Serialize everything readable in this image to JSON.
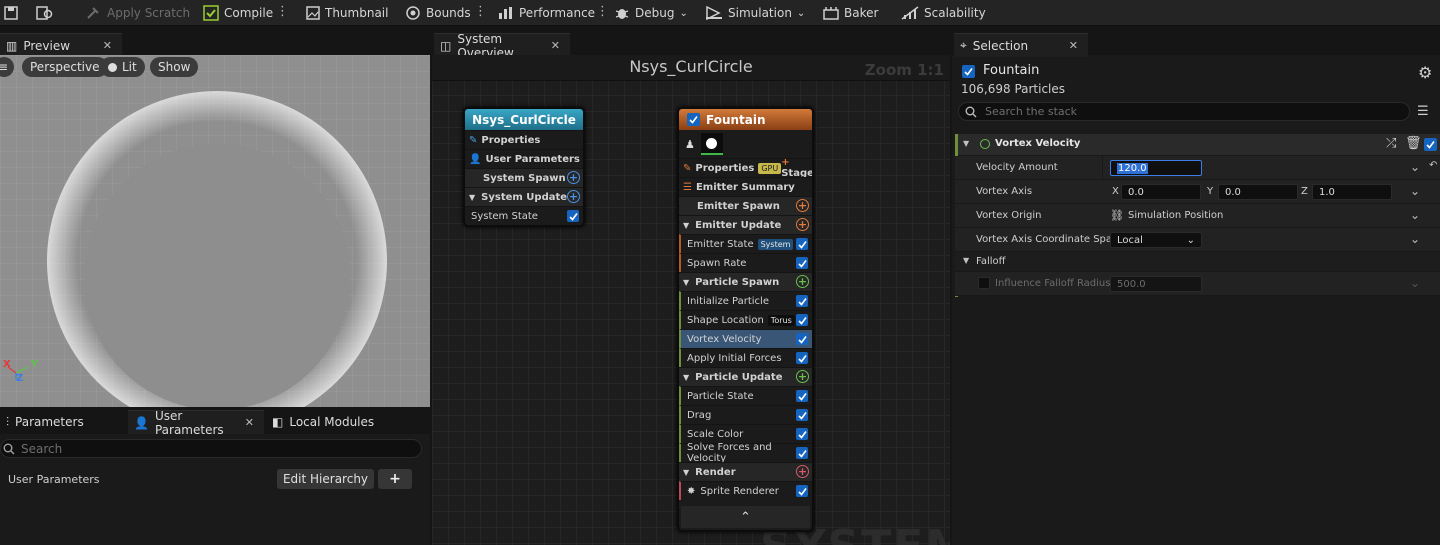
{
  "toolbar": {
    "apply_scratch": "Apply Scratch",
    "compile": "Compile",
    "thumbnail": "Thumbnail",
    "bounds": "Bounds",
    "performance": "Performance",
    "debug": "Debug",
    "simulation": "Simulation",
    "baker": "Baker",
    "scalability": "Scalability"
  },
  "preview": {
    "tab": "Preview",
    "view_mode": "Perspective",
    "lighting": "Lit",
    "show": "Show",
    "axis_x": "X",
    "axis_y": "Y",
    "axis_z": "Z"
  },
  "params": {
    "tabs": [
      "Parameters",
      "User Parameters",
      "Local Modules"
    ],
    "search_placeholder": "Search",
    "section_label": "User Parameters",
    "edit_hierarchy": "Edit Hierarchy",
    "add": "+"
  },
  "graph": {
    "tab": "System Overview",
    "title": "Nsys_CurlCircle",
    "zoom": "Zoom 1:1",
    "watermark": "SYSTEM",
    "system_node": {
      "title": "Nsys_CurlCircle",
      "rows": [
        "Properties",
        "User Parameters",
        "System Spawn",
        "System Update",
        "System State"
      ]
    },
    "emitter_node": {
      "title": "Fountain",
      "properties": "Properties",
      "gpu_badge": "GPU",
      "stage": "Stage",
      "rows": [
        "Emitter Summary",
        "Emitter Spawn",
        "Emitter Update",
        "Emitter State",
        "Spawn Rate",
        "Particle Spawn",
        "Initialize Particle",
        "Shape Location",
        "Vortex Velocity",
        "Apply Initial Forces",
        "Particle Update",
        "Particle State",
        "Drag",
        "Scale Color",
        "Solve Forces and Velocity",
        "Render",
        "Sprite Renderer"
      ],
      "emitter_state_badge": "System",
      "shape_location_badge": "Torus",
      "collapse": "⌃"
    }
  },
  "selection": {
    "tab": "Selection",
    "emitter_name": "Fountain",
    "particle_count": "106,698 Particles",
    "search_placeholder": "Search the stack",
    "module_title": "Vortex Velocity",
    "velocity_amount_label": "Velocity Amount",
    "velocity_amount": "120.0",
    "vortex_axis_label": "Vortex Axis",
    "axis_x_label": "X",
    "axis_x": "0.0",
    "axis_y_label": "Y",
    "axis_y": "0.0",
    "axis_z_label": "Z",
    "axis_z": "1.0",
    "vortex_origin_label": "Vortex Origin",
    "vortex_origin": "Simulation Position",
    "coord_space_label": "Vortex Axis Coordinate Space",
    "coord_space": "Local",
    "falloff_label": "Falloff",
    "influence_label": "Influence Falloff Radius",
    "influence": "500.0"
  },
  "colors": {
    "system_header": "#2a8aa6",
    "emitter_header": "#b25a20",
    "accent_blue": "#1565c0",
    "selected_row": "#3a5676",
    "module_bar": "#6f8f3a"
  }
}
